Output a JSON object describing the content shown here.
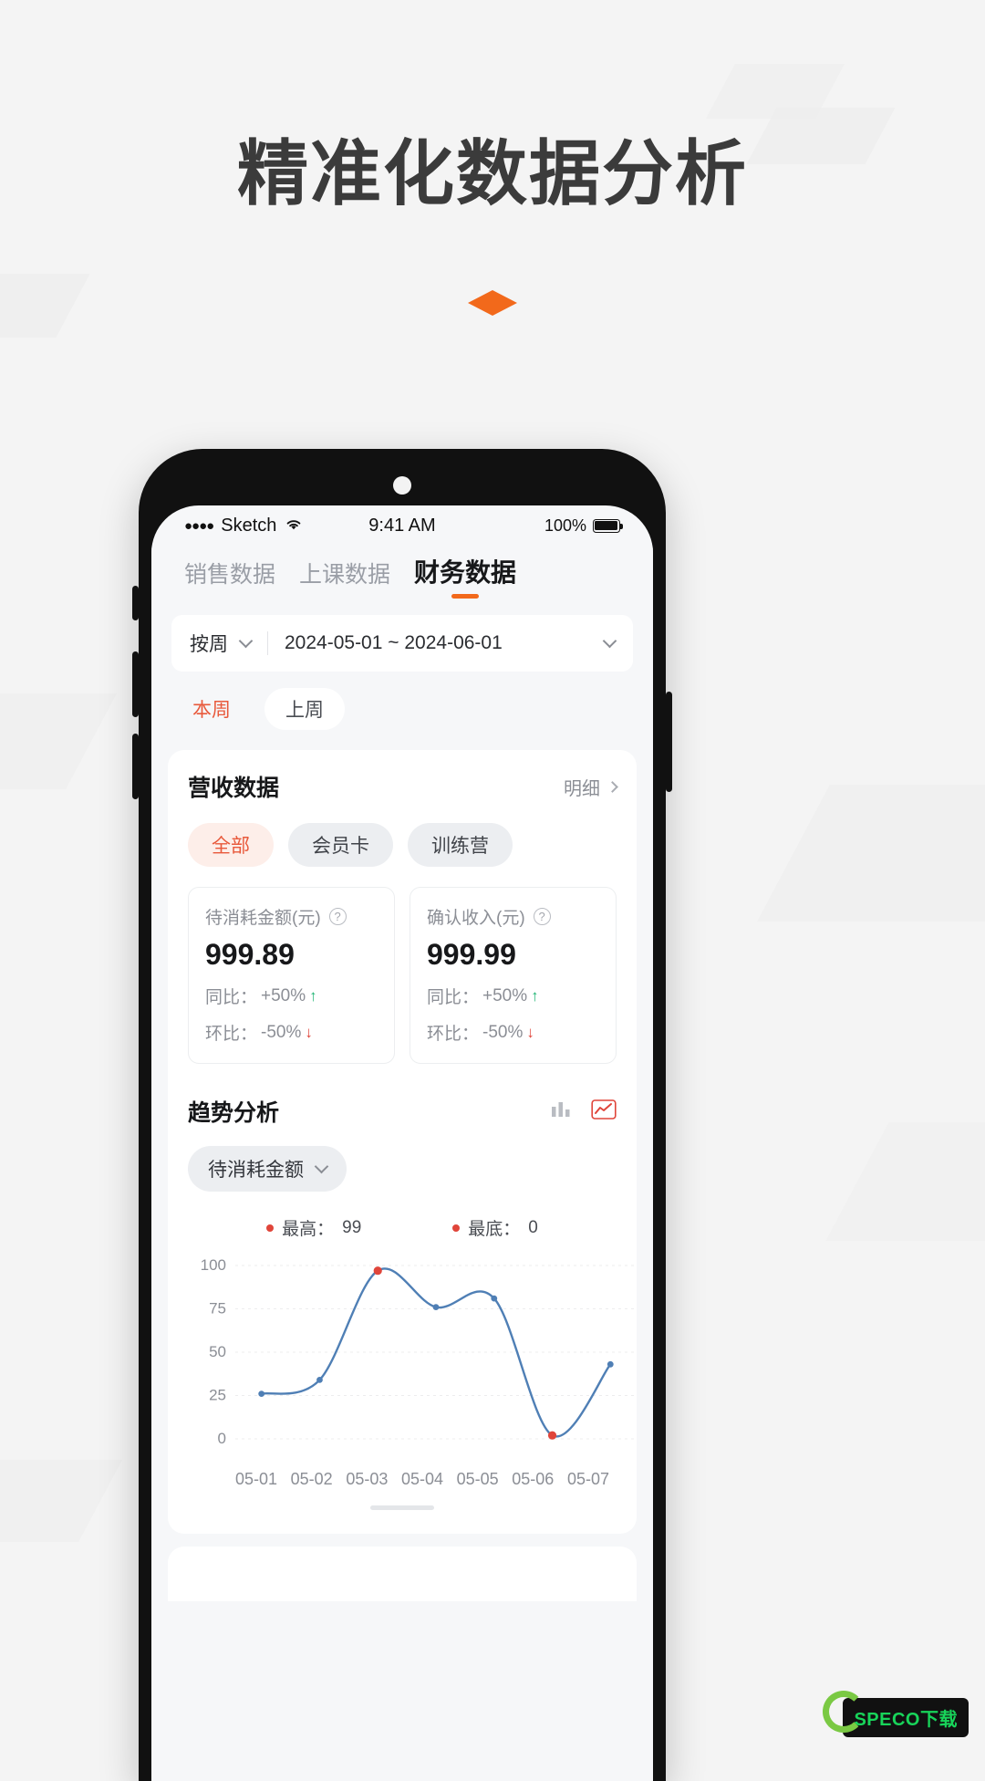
{
  "headline": "精准化数据分析",
  "diamond_color": "#f2691b",
  "status_bar": {
    "dots": "●●●●",
    "carrier": "Sketch",
    "wifi_icon": "wifi-icon",
    "time": "9:41 AM",
    "battery": "100%"
  },
  "tabs": [
    {
      "label": "销售数据",
      "active": false
    },
    {
      "label": "上课数据",
      "active": false
    },
    {
      "label": "财务数据",
      "active": true
    }
  ],
  "date_bar": {
    "period_type": "按周",
    "range": "2024-05-01 ~ 2024-06-01"
  },
  "week_toggle": [
    {
      "label": "本周",
      "active": true
    },
    {
      "label": "上周",
      "active": false
    }
  ],
  "revenue_card": {
    "title": "营收数据",
    "detail_label": "明细",
    "chips": [
      {
        "label": "全部",
        "active": true
      },
      {
        "label": "会员卡",
        "active": false
      },
      {
        "label": "训练营",
        "active": false
      }
    ],
    "metrics": [
      {
        "label": "待消耗金额(元)",
        "value": "999.89",
        "yoy_label": "同比：",
        "yoy_value": "+50%",
        "yoy_arrow": "↑",
        "mom_label": "环比：",
        "mom_value": "-50%",
        "mom_arrow": "↓"
      },
      {
        "label": "确认收入(元)",
        "value": "999.99",
        "yoy_label": "同比：",
        "yoy_value": "+50%",
        "yoy_arrow": "↑",
        "mom_label": "环比：",
        "mom_value": "-50%",
        "mom_arrow": "↓"
      }
    ],
    "trend": {
      "title": "趋势分析",
      "bar_icon": "bar-chart-icon",
      "line_icon": "line-chart-icon",
      "selector": "待消耗金额",
      "legend": [
        {
          "label": "最高：",
          "value": "99"
        },
        {
          "label": "最底：",
          "value": "0"
        }
      ]
    }
  },
  "chart_data": {
    "type": "line",
    "title": "趋势分析",
    "series_name": "待消耗金额",
    "categories": [
      "05-01",
      "05-02",
      "05-03",
      "05-04",
      "05-05",
      "05-06",
      "05-07"
    ],
    "values": [
      26,
      34,
      97,
      76,
      81,
      2,
      43
    ],
    "ytick_labels": [
      "0",
      "25",
      "50",
      "75",
      "100"
    ],
    "ylim": [
      0,
      100
    ],
    "xlabel": "",
    "ylabel": "",
    "grid": true,
    "line_color": "#4f7fb5",
    "max_point": {
      "label": "最高：",
      "value": 99
    },
    "min_point": {
      "label": "最底：",
      "value": 0
    }
  },
  "watermark": {
    "text": "SPECO下载"
  }
}
